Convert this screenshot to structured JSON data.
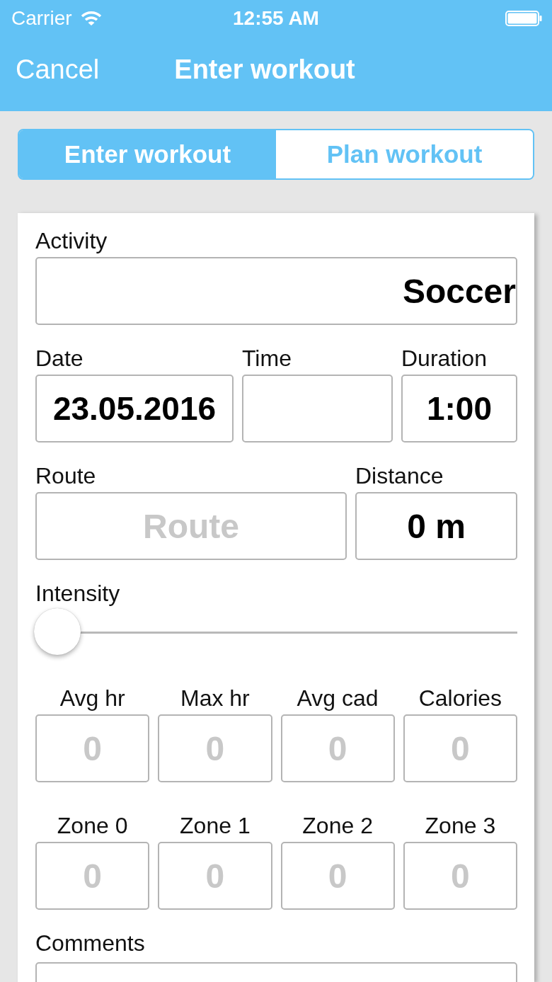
{
  "status_bar": {
    "carrier": "Carrier",
    "time": "12:55 AM"
  },
  "nav_bar": {
    "cancel": "Cancel",
    "title": "Enter workout"
  },
  "segments": [
    {
      "label": "Enter workout",
      "selected": true
    },
    {
      "label": "Plan workout",
      "selected": false
    }
  ],
  "form": {
    "activity": {
      "label": "Activity",
      "value": "Soccer"
    },
    "when": [
      {
        "label": "Date",
        "value": "23.05.2016"
      },
      {
        "label": "Time"
      },
      {
        "label": "Duration",
        "value": "1:00"
      }
    ],
    "route": [
      {
        "label": "Route",
        "placeholder": "Route"
      },
      {
        "label": "Distance",
        "value": "0 m"
      }
    ],
    "intensity": {
      "label": "Intensity",
      "level": 0
    },
    "heart": [
      {
        "label": "Avg hr",
        "placeholder": "0"
      },
      {
        "label": "Max hr",
        "placeholder": "0"
      },
      {
        "label": "Avg cad",
        "placeholder": "0"
      },
      {
        "label": "Calories",
        "placeholder": "0"
      }
    ],
    "zones": [
      {
        "label": "Zone 0",
        "placeholder": "0"
      },
      {
        "label": "Zone 1",
        "placeholder": "0"
      },
      {
        "label": "Zone 2",
        "placeholder": "0"
      },
      {
        "label": "Zone 3",
        "placeholder": "0"
      }
    ],
    "comments": {
      "label": "Comments"
    }
  }
}
